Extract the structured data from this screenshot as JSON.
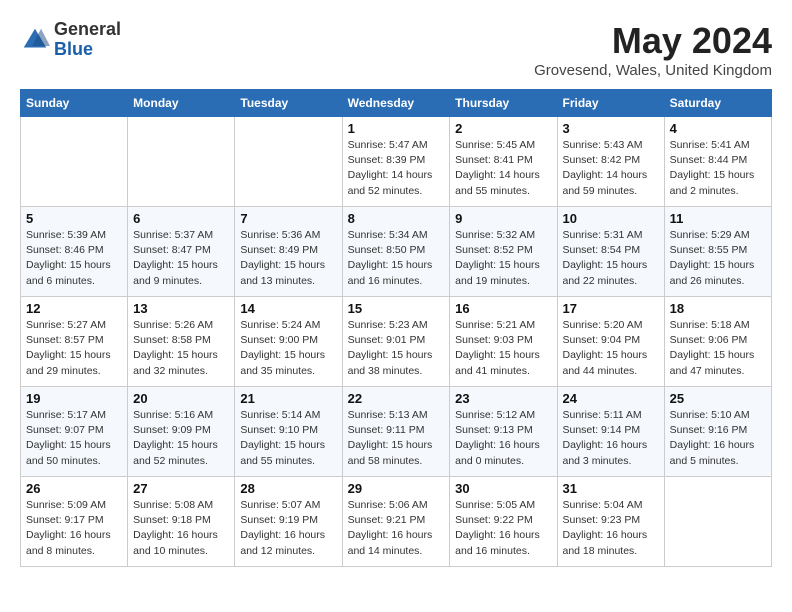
{
  "header": {
    "logo_general": "General",
    "logo_blue": "Blue",
    "month_title": "May 2024",
    "location": "Grovesend, Wales, United Kingdom"
  },
  "weekdays": [
    "Sunday",
    "Monday",
    "Tuesday",
    "Wednesday",
    "Thursday",
    "Friday",
    "Saturday"
  ],
  "weeks": [
    [
      {
        "day": "",
        "info": ""
      },
      {
        "day": "",
        "info": ""
      },
      {
        "day": "",
        "info": ""
      },
      {
        "day": "1",
        "info": "Sunrise: 5:47 AM\nSunset: 8:39 PM\nDaylight: 14 hours and 52 minutes."
      },
      {
        "day": "2",
        "info": "Sunrise: 5:45 AM\nSunset: 8:41 PM\nDaylight: 14 hours and 55 minutes."
      },
      {
        "day": "3",
        "info": "Sunrise: 5:43 AM\nSunset: 8:42 PM\nDaylight: 14 hours and 59 minutes."
      },
      {
        "day": "4",
        "info": "Sunrise: 5:41 AM\nSunset: 8:44 PM\nDaylight: 15 hours and 2 minutes."
      }
    ],
    [
      {
        "day": "5",
        "info": "Sunrise: 5:39 AM\nSunset: 8:46 PM\nDaylight: 15 hours and 6 minutes."
      },
      {
        "day": "6",
        "info": "Sunrise: 5:37 AM\nSunset: 8:47 PM\nDaylight: 15 hours and 9 minutes."
      },
      {
        "day": "7",
        "info": "Sunrise: 5:36 AM\nSunset: 8:49 PM\nDaylight: 15 hours and 13 minutes."
      },
      {
        "day": "8",
        "info": "Sunrise: 5:34 AM\nSunset: 8:50 PM\nDaylight: 15 hours and 16 minutes."
      },
      {
        "day": "9",
        "info": "Sunrise: 5:32 AM\nSunset: 8:52 PM\nDaylight: 15 hours and 19 minutes."
      },
      {
        "day": "10",
        "info": "Sunrise: 5:31 AM\nSunset: 8:54 PM\nDaylight: 15 hours and 22 minutes."
      },
      {
        "day": "11",
        "info": "Sunrise: 5:29 AM\nSunset: 8:55 PM\nDaylight: 15 hours and 26 minutes."
      }
    ],
    [
      {
        "day": "12",
        "info": "Sunrise: 5:27 AM\nSunset: 8:57 PM\nDaylight: 15 hours and 29 minutes."
      },
      {
        "day": "13",
        "info": "Sunrise: 5:26 AM\nSunset: 8:58 PM\nDaylight: 15 hours and 32 minutes."
      },
      {
        "day": "14",
        "info": "Sunrise: 5:24 AM\nSunset: 9:00 PM\nDaylight: 15 hours and 35 minutes."
      },
      {
        "day": "15",
        "info": "Sunrise: 5:23 AM\nSunset: 9:01 PM\nDaylight: 15 hours and 38 minutes."
      },
      {
        "day": "16",
        "info": "Sunrise: 5:21 AM\nSunset: 9:03 PM\nDaylight: 15 hours and 41 minutes."
      },
      {
        "day": "17",
        "info": "Sunrise: 5:20 AM\nSunset: 9:04 PM\nDaylight: 15 hours and 44 minutes."
      },
      {
        "day": "18",
        "info": "Sunrise: 5:18 AM\nSunset: 9:06 PM\nDaylight: 15 hours and 47 minutes."
      }
    ],
    [
      {
        "day": "19",
        "info": "Sunrise: 5:17 AM\nSunset: 9:07 PM\nDaylight: 15 hours and 50 minutes."
      },
      {
        "day": "20",
        "info": "Sunrise: 5:16 AM\nSunset: 9:09 PM\nDaylight: 15 hours and 52 minutes."
      },
      {
        "day": "21",
        "info": "Sunrise: 5:14 AM\nSunset: 9:10 PM\nDaylight: 15 hours and 55 minutes."
      },
      {
        "day": "22",
        "info": "Sunrise: 5:13 AM\nSunset: 9:11 PM\nDaylight: 15 hours and 58 minutes."
      },
      {
        "day": "23",
        "info": "Sunrise: 5:12 AM\nSunset: 9:13 PM\nDaylight: 16 hours and 0 minutes."
      },
      {
        "day": "24",
        "info": "Sunrise: 5:11 AM\nSunset: 9:14 PM\nDaylight: 16 hours and 3 minutes."
      },
      {
        "day": "25",
        "info": "Sunrise: 5:10 AM\nSunset: 9:16 PM\nDaylight: 16 hours and 5 minutes."
      }
    ],
    [
      {
        "day": "26",
        "info": "Sunrise: 5:09 AM\nSunset: 9:17 PM\nDaylight: 16 hours and 8 minutes."
      },
      {
        "day": "27",
        "info": "Sunrise: 5:08 AM\nSunset: 9:18 PM\nDaylight: 16 hours and 10 minutes."
      },
      {
        "day": "28",
        "info": "Sunrise: 5:07 AM\nSunset: 9:19 PM\nDaylight: 16 hours and 12 minutes."
      },
      {
        "day": "29",
        "info": "Sunrise: 5:06 AM\nSunset: 9:21 PM\nDaylight: 16 hours and 14 minutes."
      },
      {
        "day": "30",
        "info": "Sunrise: 5:05 AM\nSunset: 9:22 PM\nDaylight: 16 hours and 16 minutes."
      },
      {
        "day": "31",
        "info": "Sunrise: 5:04 AM\nSunset: 9:23 PM\nDaylight: 16 hours and 18 minutes."
      },
      {
        "day": "",
        "info": ""
      }
    ]
  ]
}
